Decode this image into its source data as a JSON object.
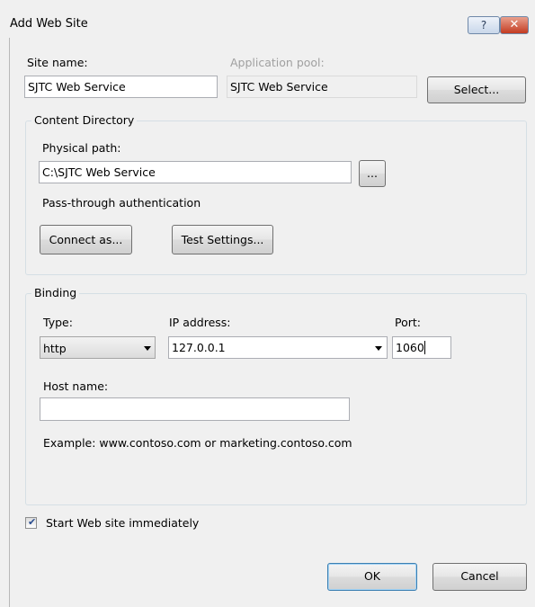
{
  "window": {
    "title": "Add Web Site",
    "help_glyph": "?",
    "close_glyph": "✕"
  },
  "site": {
    "site_name_label": "Site name:",
    "site_name_value": "SJTC Web Service",
    "app_pool_label": "Application pool:",
    "app_pool_value": "SJTC Web Service",
    "select_button": "Select..."
  },
  "content_directory": {
    "group_title": "Content Directory",
    "physical_path_label": "Physical path:",
    "physical_path_value": "C:\\SJTC Web Service",
    "browse_button": "...",
    "passthrough_label": "Pass-through authentication",
    "connect_as_button": "Connect as...",
    "test_settings_button": "Test Settings..."
  },
  "binding": {
    "group_title": "Binding",
    "type_label": "Type:",
    "type_value": "http",
    "ip_label": "IP address:",
    "ip_value": "127.0.0.1",
    "port_label": "Port:",
    "port_value": "1060",
    "host_label": "Host name:",
    "host_value": "",
    "example_text": "Example: www.contoso.com or marketing.contoso.com"
  },
  "start_immediately": {
    "label": "Start Web site immediately",
    "checked": true
  },
  "footer": {
    "ok_button": "OK",
    "cancel_button": "Cancel"
  },
  "colors": {
    "accent": "#3c7fb1",
    "close": "#c33b21"
  }
}
